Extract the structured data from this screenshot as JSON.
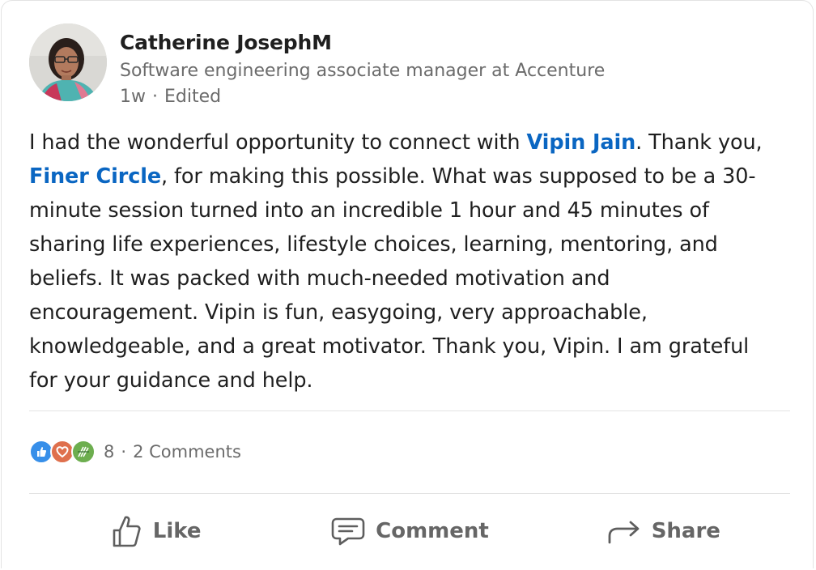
{
  "post": {
    "author_name": "Catherine JosephM",
    "author_headline": "Software engineering associate manager at Accenture",
    "time_ago": "1w",
    "meta_separator": "·",
    "edited_label": "Edited",
    "text": {
      "part1": "I had the wonderful opportunity to connect with ",
      "mention1": "Vipin Jain",
      "part2": ". Thank you, ",
      "mention2": "Finer Circle",
      "part3": ", for making this possible. What was supposed to be a 30-minute session turned into an incredible 1 hour and 45 minutes of sharing life experiences, lifestyle choices, learning, mentoring, and beliefs. It was packed with much-needed motivation and encouragement. Vipin is fun, easygoing, very approachable, knowledgeable, and a great motivator. Thank you, Vipin. I am grateful for your guidance and help."
    }
  },
  "social": {
    "reaction_icons": [
      "like-reaction-icon",
      "love-reaction-icon",
      "support-reaction-icon"
    ],
    "reaction_count": "8",
    "separator": "·",
    "comments_label": "2 Comments"
  },
  "actions": {
    "like_label": "Like",
    "comment_label": "Comment",
    "share_label": "Share"
  },
  "colors": {
    "link": "#0a66c2",
    "text": "#1f1f1f",
    "muted": "#6b6b6b",
    "like_reaction": "#378fe9",
    "love_reaction": "#df704d",
    "support_reaction": "#6dae4f"
  }
}
